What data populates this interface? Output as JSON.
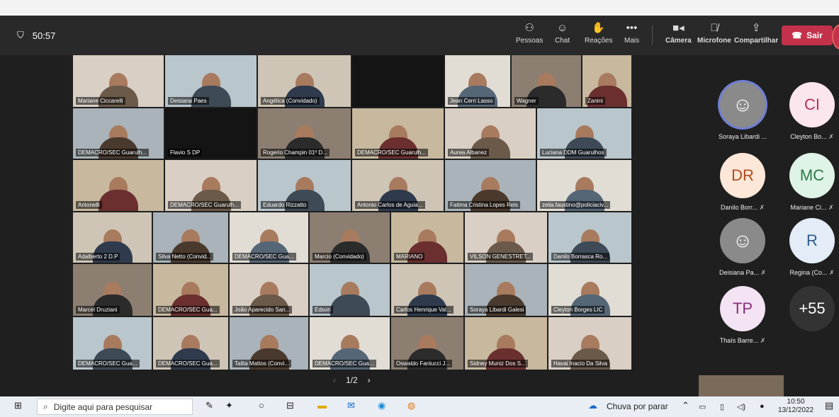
{
  "meeting": {
    "timer": "50:57",
    "controls": [
      {
        "label": "Pessoas",
        "icon": "people-icon"
      },
      {
        "label": "Chat",
        "icon": "chat-icon"
      },
      {
        "label": "Reações",
        "icon": "reactions-icon"
      },
      {
        "label": "Mais",
        "icon": "more-icon"
      },
      {
        "label": "Câmera",
        "icon": "camera-icon"
      },
      {
        "label": "Microfone",
        "icon": "microphone-off-icon"
      },
      {
        "label": "Compartilhar",
        "icon": "share-icon"
      }
    ],
    "leave_label": "Sair",
    "pager": {
      "current": "1/2"
    }
  },
  "tiles": [
    "Mariane Ciccarelli",
    "Deisiana Paes",
    "Angélica (Convidado)",
    "Jean Cerri Lasso",
    "Wagner",
    "Zanini",
    "DEMACRO/SEC Guarulh...",
    "Flavio S DP",
    "Rogerio Champin 01º D...",
    "DEMACRO/SEC Guarulh...",
    "Aurea Albanez",
    "Luciana DDM Guarulhos",
    "Antonelli",
    "DEMACRO/SEC Guarulh...",
    "Eduardo Rizzatto",
    "Antonio Carlos de Aguia...",
    "Fatima Cristina Lopes Reis",
    "zelia.faustino@policiaciv...",
    "Adalberto 2 D.P",
    "Silva Netto (Convid...",
    "DEMACRO/SEC Gua...",
    "Marcio (Convidado)",
    "MARIANO",
    "VILSON GENESTRET...",
    "Danilo Borrasca Ro...",
    "Marcel Druziani",
    "DEMACRO/SEC Gua...",
    "João Aparecido San...",
    "Edson",
    "Carlos Henrique Val...",
    "Soraya Libardi Galesi",
    "Cleyton Borges LIC",
    "DEMACRO/SEC Gua...",
    "DEMACRO/SEC Gua...",
    "Talita Mattos (Convi...",
    "DEMACRO/SEC Gua...",
    "Oswaldo Fanlucci J...",
    "Sidney Muniz Dos S...",
    "Havai Inacio Da Silva"
  ],
  "participants": [
    {
      "initials": "",
      "name": "Soraya Libardi ...",
      "bg": "#8a8a8a",
      "fg": "#ffffff"
    },
    {
      "initials": "CI",
      "name": "Cleyton Bo...",
      "bg": "#fbe6ee",
      "fg": "#b3325a"
    },
    {
      "initials": "DR",
      "name": "Danilo Borr...",
      "bg": "#fde7d9",
      "fg": "#b34a1a"
    },
    {
      "initials": "MC",
      "name": "Mariane Ci...",
      "bg": "#dff3e6",
      "fg": "#2b7a4b"
    },
    {
      "initials": "",
      "name": "Deisiana Pa...",
      "bg": "#8a8a8a",
      "fg": "#ffffff"
    },
    {
      "initials": "R",
      "name": "Regina (Co...",
      "bg": "#e3ecf7",
      "fg": "#2d5a8a"
    },
    {
      "initials": "TP",
      "name": "Thaís Barre...",
      "bg": "#f3e3f3",
      "fg": "#8a2d7a"
    },
    {
      "initials": "+55",
      "name": "",
      "bg": "#333333",
      "fg": "#ffffff"
    }
  ],
  "taskbar": {
    "search_placeholder": "Digite aqui para pesquisar",
    "weather": "Chuva por parar",
    "time": "10:50",
    "date": "13/12/2022"
  }
}
